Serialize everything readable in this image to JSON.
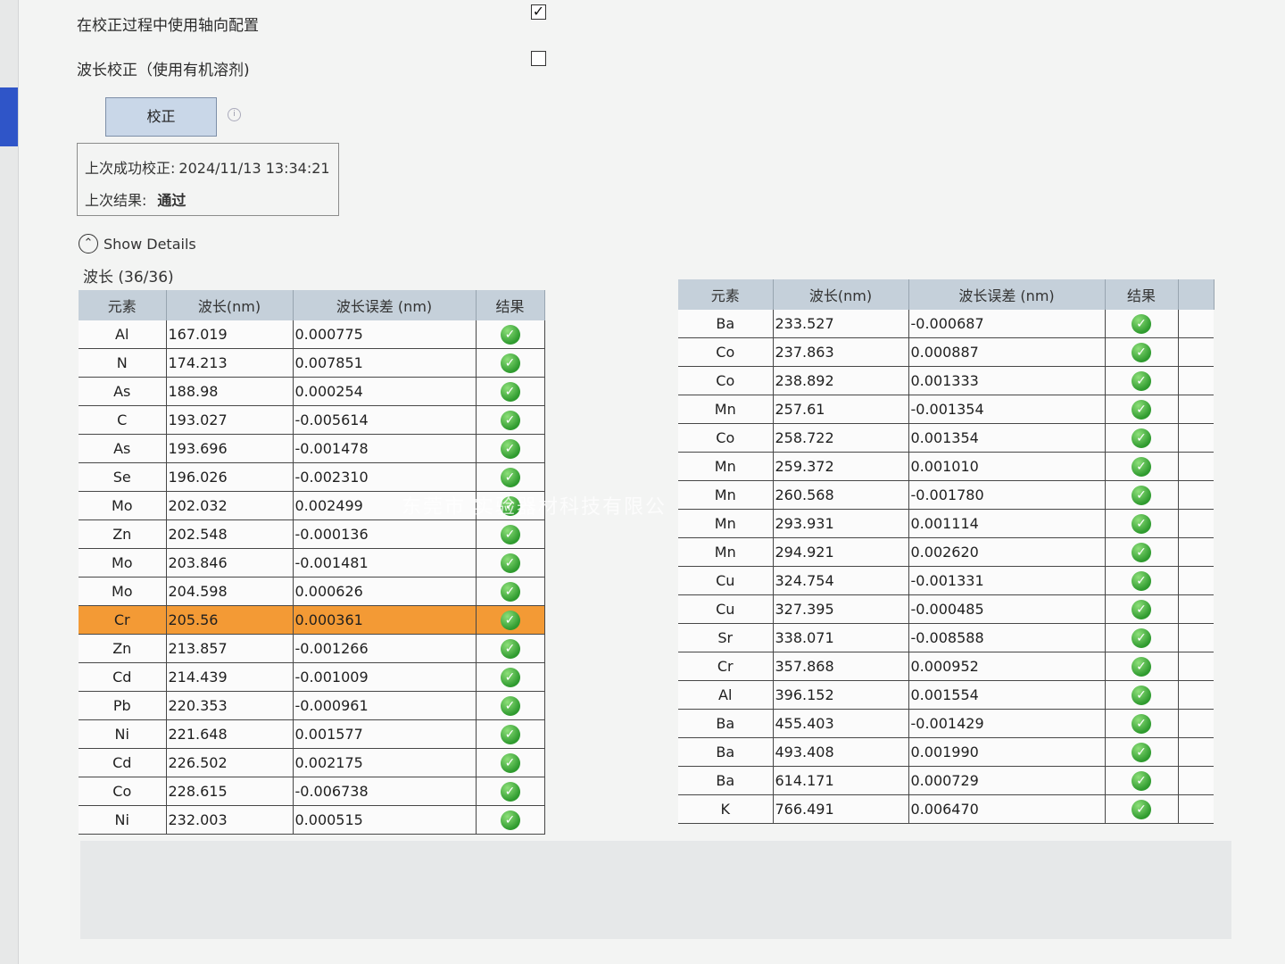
{
  "options": {
    "axial_config_label": "在校正过程中使用轴向配置",
    "axial_config_checked": true,
    "axial_config_mark": "✓",
    "wavelength_label": "波长校正（使用有机溶剂)",
    "wavelength_checked": false
  },
  "calibrate_button": "校正",
  "last": {
    "success_label": "上次成功校正:",
    "success_time": "2024/11/13 13:34:21",
    "result_label": "上次结果:",
    "result_value": "通过"
  },
  "show_details": "Show Details",
  "wavelength_count": "波长 (36/36)",
  "columns": {
    "element": "元素",
    "wavelength": "波长(nm)",
    "error": "波长误差 (nm)",
    "result": "结果"
  },
  "result_icon": "check-circle",
  "left_rows": [
    {
      "el": "Al",
      "wl": "167.019",
      "err": "0.000775"
    },
    {
      "el": "N",
      "wl": "174.213",
      "err": "0.007851"
    },
    {
      "el": "As",
      "wl": "188.98",
      "err": "0.000254"
    },
    {
      "el": "C",
      "wl": "193.027",
      "err": "-0.005614"
    },
    {
      "el": "As",
      "wl": "193.696",
      "err": "-0.001478"
    },
    {
      "el": "Se",
      "wl": "196.026",
      "err": "-0.002310"
    },
    {
      "el": "Mo",
      "wl": "202.032",
      "err": "0.002499"
    },
    {
      "el": "Zn",
      "wl": "202.548",
      "err": "-0.000136"
    },
    {
      "el": "Mo",
      "wl": "203.846",
      "err": "-0.001481"
    },
    {
      "el": "Mo",
      "wl": "204.598",
      "err": "0.000626"
    },
    {
      "el": "Cr",
      "wl": "205.56",
      "err": "0.000361",
      "selected": true
    },
    {
      "el": "Zn",
      "wl": "213.857",
      "err": "-0.001266"
    },
    {
      "el": "Cd",
      "wl": "214.439",
      "err": "-0.001009"
    },
    {
      "el": "Pb",
      "wl": "220.353",
      "err": "-0.000961"
    },
    {
      "el": "Ni",
      "wl": "221.648",
      "err": "0.001577"
    },
    {
      "el": "Cd",
      "wl": "226.502",
      "err": "0.002175"
    },
    {
      "el": "Co",
      "wl": "228.615",
      "err": "-0.006738"
    },
    {
      "el": "Ni",
      "wl": "232.003",
      "err": "0.000515"
    }
  ],
  "right_rows": [
    {
      "el": "Ba",
      "wl": "233.527",
      "err": "-0.000687"
    },
    {
      "el": "Co",
      "wl": "237.863",
      "err": "0.000887"
    },
    {
      "el": "Co",
      "wl": "238.892",
      "err": "0.001333"
    },
    {
      "el": "Mn",
      "wl": "257.61",
      "err": "-0.001354"
    },
    {
      "el": "Co",
      "wl": "258.722",
      "err": "0.001354"
    },
    {
      "el": "Mn",
      "wl": "259.372",
      "err": "0.001010"
    },
    {
      "el": "Mn",
      "wl": "260.568",
      "err": "-0.001780"
    },
    {
      "el": "Mn",
      "wl": "293.931",
      "err": "0.001114"
    },
    {
      "el": "Mn",
      "wl": "294.921",
      "err": "0.002620"
    },
    {
      "el": "Cu",
      "wl": "324.754",
      "err": "-0.001331"
    },
    {
      "el": "Cu",
      "wl": "327.395",
      "err": "-0.000485"
    },
    {
      "el": "Sr",
      "wl": "338.071",
      "err": "-0.008588"
    },
    {
      "el": "Cr",
      "wl": "357.868",
      "err": "0.000952"
    },
    {
      "el": "Al",
      "wl": "396.152",
      "err": "0.001554"
    },
    {
      "el": "Ba",
      "wl": "455.403",
      "err": "-0.001429"
    },
    {
      "el": "Ba",
      "wl": "493.408",
      "err": "0.001990"
    },
    {
      "el": "Ba",
      "wl": "614.171",
      "err": "0.000729"
    },
    {
      "el": "K",
      "wl": "766.491",
      "err": "0.006470"
    }
  ],
  "watermark": "东莞市 实验器材科技有限公"
}
